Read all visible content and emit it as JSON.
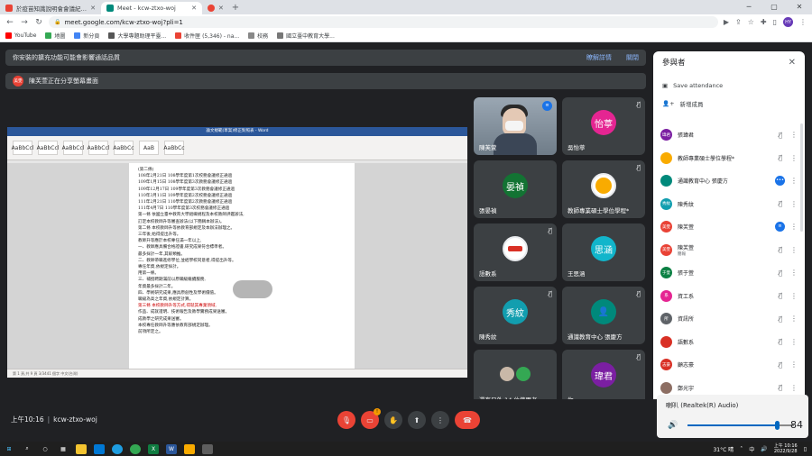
{
  "browser": {
    "tabs": [
      {
        "title": "於疫苗知識說明會會議紀錄 - ce",
        "favicon_color": "#ea4335",
        "active": false
      },
      {
        "title": "Meet - kcw-ztxo-woj",
        "favicon_color": "#00897b",
        "active": true
      },
      {
        "title": "",
        "favicon_color": "#ea4335",
        "active": false
      }
    ],
    "url": "meet.google.com/kcw-ztxo-woj?pli=1",
    "profile_initials": "HY",
    "bookmarks": [
      {
        "label": "YouTube",
        "color": "#ff0000"
      },
      {
        "label": "地圖",
        "color": "#34a853"
      },
      {
        "label": "新分頁",
        "color": "#4285f4"
      },
      {
        "label": "大學專題助理平臺...",
        "color": "#555555"
      },
      {
        "label": "收件匣 (5,346) - na...",
        "color": "#ea4335"
      },
      {
        "label": "校務",
        "color": "#888888"
      },
      {
        "label": "國立臺中教育大學...",
        "color": "#777777"
      }
    ]
  },
  "banners": {
    "extension_notice": "你安裝的擴充功能可能會影響通話品質",
    "learn_more": "瞭解詳情",
    "close": "關閉",
    "presenting_avatar": "美雯",
    "presenting_text": "陳芙萱正在分享螢幕畫面"
  },
  "presentation": {
    "window_title": "論文規範(草案)修正對照表 - Word",
    "ribbon_styles": [
      "AaBbCcl",
      "AaBbCcl",
      "AaBbCcl",
      "AaBbCcl",
      "AaBbCc",
      "AaB",
      "AaBbCc"
    ],
    "lines": [
      {
        "text": "(第二條)",
        "red": false
      },
      {
        "text": "108年2月21日 108學年度第1次校務會議修正通過",
        "red": false
      },
      {
        "text": "109年1月15日 108學年度第3次教務會議修正通過",
        "red": false
      },
      {
        "text": "109年12月17日 109學年度第3次教務會議修正通過",
        "red": false
      },
      {
        "text": "110年3月11日 109學年度第2次校務會議修正通過",
        "red": false
      },
      {
        "text": "111年2月21日 110學年度第2次教務會議修正通過",
        "red": false
      },
      {
        "text": "111年4月7日 110學年度第3次校務會議修正通過",
        "red": false
      },
      {
        "text": "第一條  依國立臺中教育大學組織規程及本校教師評鑑辦法,",
        "red": false
      },
      {
        "text": "       訂定本校教師升等審查辦法(以下簡稱本辦法)。",
        "red": false
      },
      {
        "text": "第二條  本校教師升等依教育部規定及本辦法辦理之。",
        "red": false
      },
      {
        "text": "       三年後,始得提出升等。",
        "red": false
      },
      {
        "text": "       教師升等應於本校專任滿一年以上,",
        "red": false
      },
      {
        "text": "一、教師應具備合格證書,研究成果符合標準者。",
        "red": false
      },
      {
        "text": "       最多採計一年,其餘類推。",
        "red": false
      },
      {
        "text": "二、教師帶職進修學位,並經學校同意者,得提出升等。",
        "red": false
      },
      {
        "text": "       專任年資,依規定採計。",
        "red": false
      },
      {
        "text": "       用第一條。",
        "red": false
      },
      {
        "text": "三、補授聘期滿前以原職級繼續服務,",
        "red": false
      },
      {
        "text": "       年資最多採計二年。",
        "red": false
      },
      {
        "text": "四、學術研究成果,應具原創性及學術價值。",
        "red": false
      },
      {
        "text": "       職級為高之年資,依規定計算。",
        "red": false
      },
      {
        "text": "第三條  本校教師升等方式,得就其專業領域,",
        "red": true
      },
      {
        "text": "       作品、成就證明、技術報告及教學實務成果送審。",
        "red": false
      },
      {
        "text": "       成教學之研究成果送審。",
        "red": false
      },
      {
        "text": "       本校專任教師升等應依教育部規定辦理。",
        "red": false
      },
      {
        "text": "       前項所定之。",
        "red": false
      }
    ],
    "status_bar": "第 1 頁,共 9 頁   3/3441 個字   中文(台灣)"
  },
  "tiles": [
    {
      "name": "陳芙萱",
      "type": "video",
      "indicator": "speaking"
    },
    {
      "name": "吳怡葶",
      "type": "initials",
      "initials": "怡葶",
      "color": "#e52592",
      "indicator": "muted"
    },
    {
      "name": "張晏禎",
      "type": "initials",
      "initials": "晏禎",
      "color": "#137333",
      "indicator": "none"
    },
    {
      "name": "教師專業碩士學位學程*",
      "type": "logo",
      "color": "#f9ab00",
      "indicator": "muted"
    },
    {
      "name": "語數系",
      "type": "logo",
      "color": "#d93025",
      "indicator": "muted"
    },
    {
      "name": "王思涵",
      "type": "initials",
      "initials": "思涵",
      "color": "#12b5cb",
      "indicator": "none"
    },
    {
      "name": "陳秀紋",
      "type": "initials",
      "initials": "秀紋",
      "color": "#129eaf",
      "indicator": "muted"
    },
    {
      "name": "通識教育中心 張慶方",
      "type": "person",
      "color": "#00897b",
      "indicator": "muted"
    },
    {
      "name": "還有另外 14 位使用者",
      "type": "group",
      "indicator": "none"
    },
    {
      "name": "你",
      "type": "initials",
      "initials": "瑋君",
      "color": "#7b1fa2",
      "indicator": "muted"
    }
  ],
  "bottombar": {
    "time": "上午10:16",
    "meeting_code": "kcw-ztxo-woj",
    "raise_badge": "!"
  },
  "panel": {
    "title": "參與者",
    "save_attendance": "Save attendance",
    "add_people": "新增成員",
    "people": [
      {
        "name": "張瑋君",
        "sub": "",
        "avatar": "瑋君",
        "color": "#7b1fa2",
        "status": "muted"
      },
      {
        "name": "教師專業碩士學位學程*",
        "sub": "",
        "avatar": "",
        "color": "#f9ab00",
        "status": "muted"
      },
      {
        "name": "通識教育中心 張慶方",
        "sub": "",
        "avatar": "",
        "color": "#00897b",
        "status": "speaking-dots"
      },
      {
        "name": "陳秀紋",
        "sub": "",
        "avatar": "秀紋",
        "color": "#129eaf",
        "status": "muted"
      },
      {
        "name": "陳芙萱",
        "sub": "",
        "avatar": "美雯",
        "color": "#e94235",
        "status": "speaking"
      },
      {
        "name": "陳芙萱",
        "sub": "簡報",
        "avatar": "美雯",
        "color": "#e94235",
        "status": "muted"
      },
      {
        "name": "張于萱",
        "sub": "",
        "avatar": "于萱",
        "color": "#0b8043",
        "status": "muted"
      },
      {
        "name": "資工系",
        "sub": "",
        "avatar": "系",
        "color": "#e52592",
        "status": "muted"
      },
      {
        "name": "資訊所",
        "sub": "",
        "avatar": "所",
        "color": "#5f6368",
        "status": "muted"
      },
      {
        "name": "語數系",
        "sub": "",
        "avatar": "",
        "color": "#d93025",
        "status": "muted"
      },
      {
        "name": "顧志豪",
        "sub": "",
        "avatar": "志豪",
        "color": "#d93025",
        "status": "muted"
      },
      {
        "name": "鄭光宇",
        "sub": "",
        "avatar": "",
        "color": "#8d6e63",
        "status": "muted"
      }
    ]
  },
  "volume": {
    "device": "喇叭 (Realtek(R) Audio)",
    "level": 84
  },
  "taskbar": {
    "weather": "31°C 晴",
    "ime": "中",
    "time": "上午 10:16",
    "date": "2022/9/28"
  }
}
